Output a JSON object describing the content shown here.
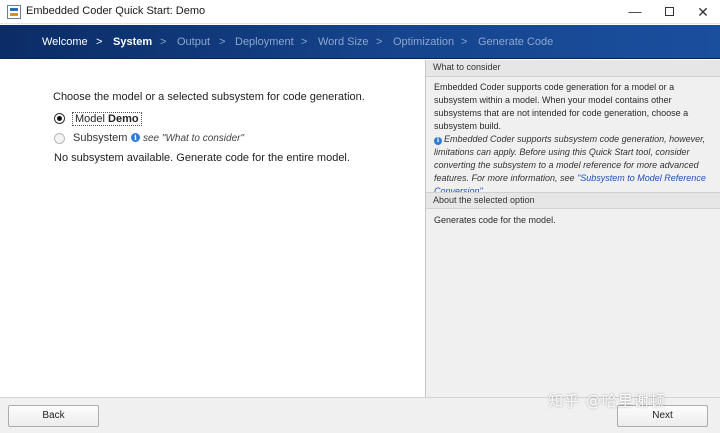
{
  "window": {
    "title": "Embedded Coder Quick Start: Demo",
    "minimize": "—",
    "close": "✕"
  },
  "nav": {
    "steps": [
      {
        "label": "Welcome",
        "state": "done"
      },
      {
        "label": "System",
        "state": "current"
      },
      {
        "label": "Output",
        "state": "pending"
      },
      {
        "label": "Deployment",
        "state": "pending"
      },
      {
        "label": "Word Size",
        "state": "pending"
      },
      {
        "label": "Optimization",
        "state": "pending"
      },
      {
        "label": "Generate Code",
        "state": "pending"
      }
    ],
    "separator": ">"
  },
  "main": {
    "prompt": "Choose the model or a selected subsystem for code generation.",
    "option_model_prefix": "Model ",
    "option_model_name": "Demo",
    "option_subsystem": "Subsystem",
    "info_glyph": "i",
    "see_note": "see \"What to consider\"",
    "no_subsystem": "No subsystem available. Generate code for the entire model."
  },
  "consider": {
    "heading": "What to consider",
    "para1": "Embedded Coder supports code generation for a model or a subsystem within a model. When your model contains other subsystems that are not intended for code generation, choose a subsystem build.",
    "note": "Embedded Coder supports subsystem code generation, however, limitations can apply. Before using this Quick Start tool, consider converting the subsystem to a model reference for more advanced features. For more information, see ",
    "link": "\"Subsystem to Model Reference Conversion\"",
    "note_end": "."
  },
  "about": {
    "heading": "About the selected option",
    "text": "Generates code for the model."
  },
  "footer": {
    "back": "Back",
    "next": "Next"
  },
  "watermark": "知乎 @哈里谢顿",
  "colors": {
    "nav_dark": "#0b2c66",
    "nav_light": "#1a4f9e",
    "link": "#1f4fb8",
    "info": "#2f7bd9"
  }
}
